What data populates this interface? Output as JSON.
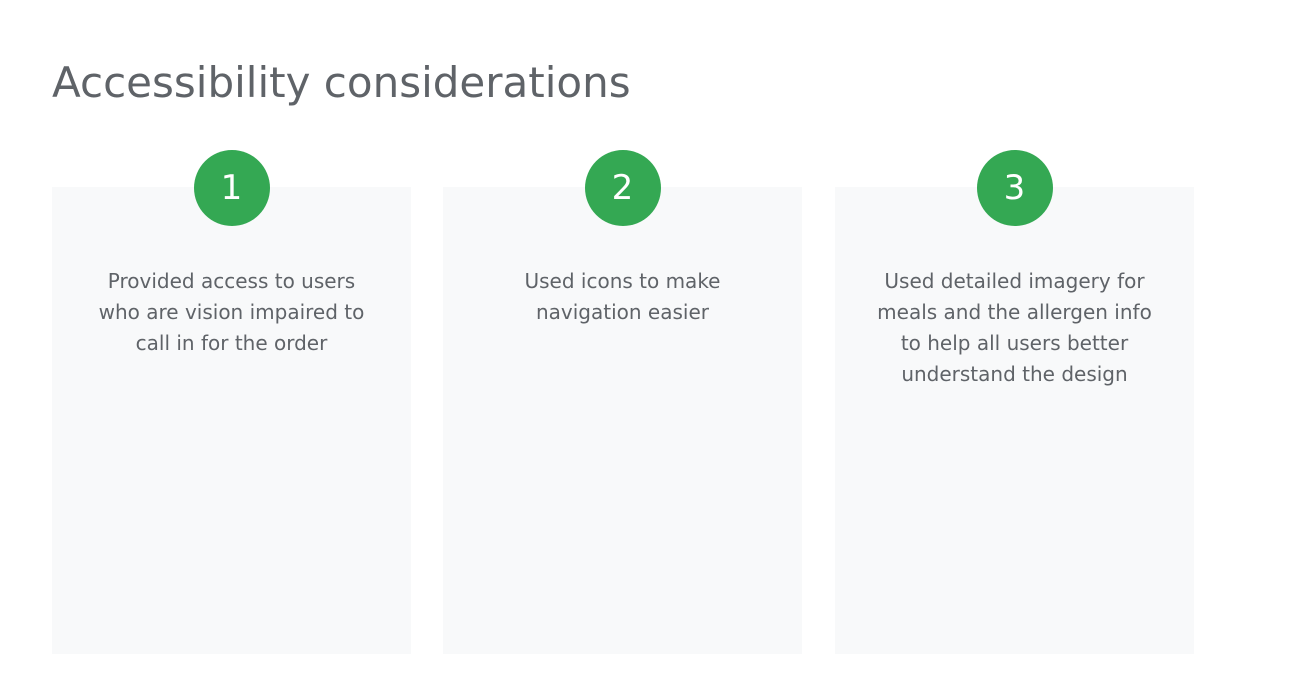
{
  "title": "Accessibility considerations",
  "colors": {
    "accent": "#34a853",
    "text": "#5f6368",
    "card_background": "#f8f9fa"
  },
  "cards": [
    {
      "number": "1",
      "text": "Provided access to users who are vision impaired to call in for the order"
    },
    {
      "number": "2",
      "text": "Used icons to make navigation easier"
    },
    {
      "number": "3",
      "text": "Used detailed imagery for meals and the allergen info to help all users better understand the design"
    }
  ]
}
